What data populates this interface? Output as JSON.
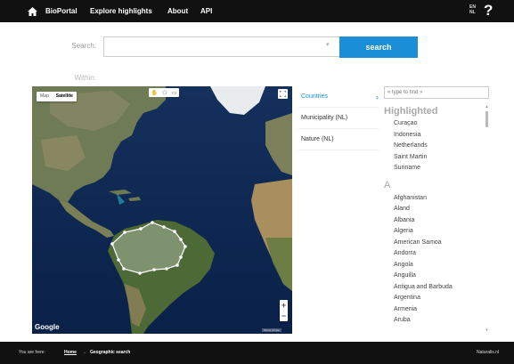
{
  "nav": {
    "items": [
      "BioPortal",
      "Explore highlights",
      "About",
      "API"
    ],
    "lang_top": "EN",
    "lang_bottom": "NL",
    "help": "?"
  },
  "search": {
    "label": "Search:",
    "placeholder": "",
    "button": "search",
    "within_label": "Within:"
  },
  "map": {
    "type_options": [
      "Map",
      "Satellite"
    ],
    "selected_type": "Satellite",
    "attribution": "Google",
    "terms": "Terms of Use",
    "zoom_in": "+",
    "zoom_out": "−"
  },
  "categories": [
    {
      "label": "Countries",
      "active": true,
      "arrow": "›"
    },
    {
      "label": "Municipality (NL)",
      "active": false
    },
    {
      "label": "Nature (NL)",
      "active": false
    }
  ],
  "list": {
    "filter_placeholder": "« type to find »",
    "highlighted_heading": "Highlighted",
    "highlighted": [
      "Curaçao",
      "Indonesia",
      "Netherlands",
      "Saint Martin",
      "Suriname"
    ],
    "letter": "A",
    "countries": [
      "Afghanistan",
      "Aland",
      "Albania",
      "Algeria",
      "American Samoa",
      "Andorra",
      "Angola",
      "Anguilla",
      "Antigua and Barbuda",
      "Argentina",
      "Armenia",
      "Aruba"
    ]
  },
  "footer": {
    "you_are_here": "You are here:",
    "home": "Home",
    "separator": "→",
    "current": "Geographic search",
    "brand": "Naturalis.nl"
  },
  "colors": {
    "accent": "#1a8fd8",
    "bar": "#111111"
  }
}
